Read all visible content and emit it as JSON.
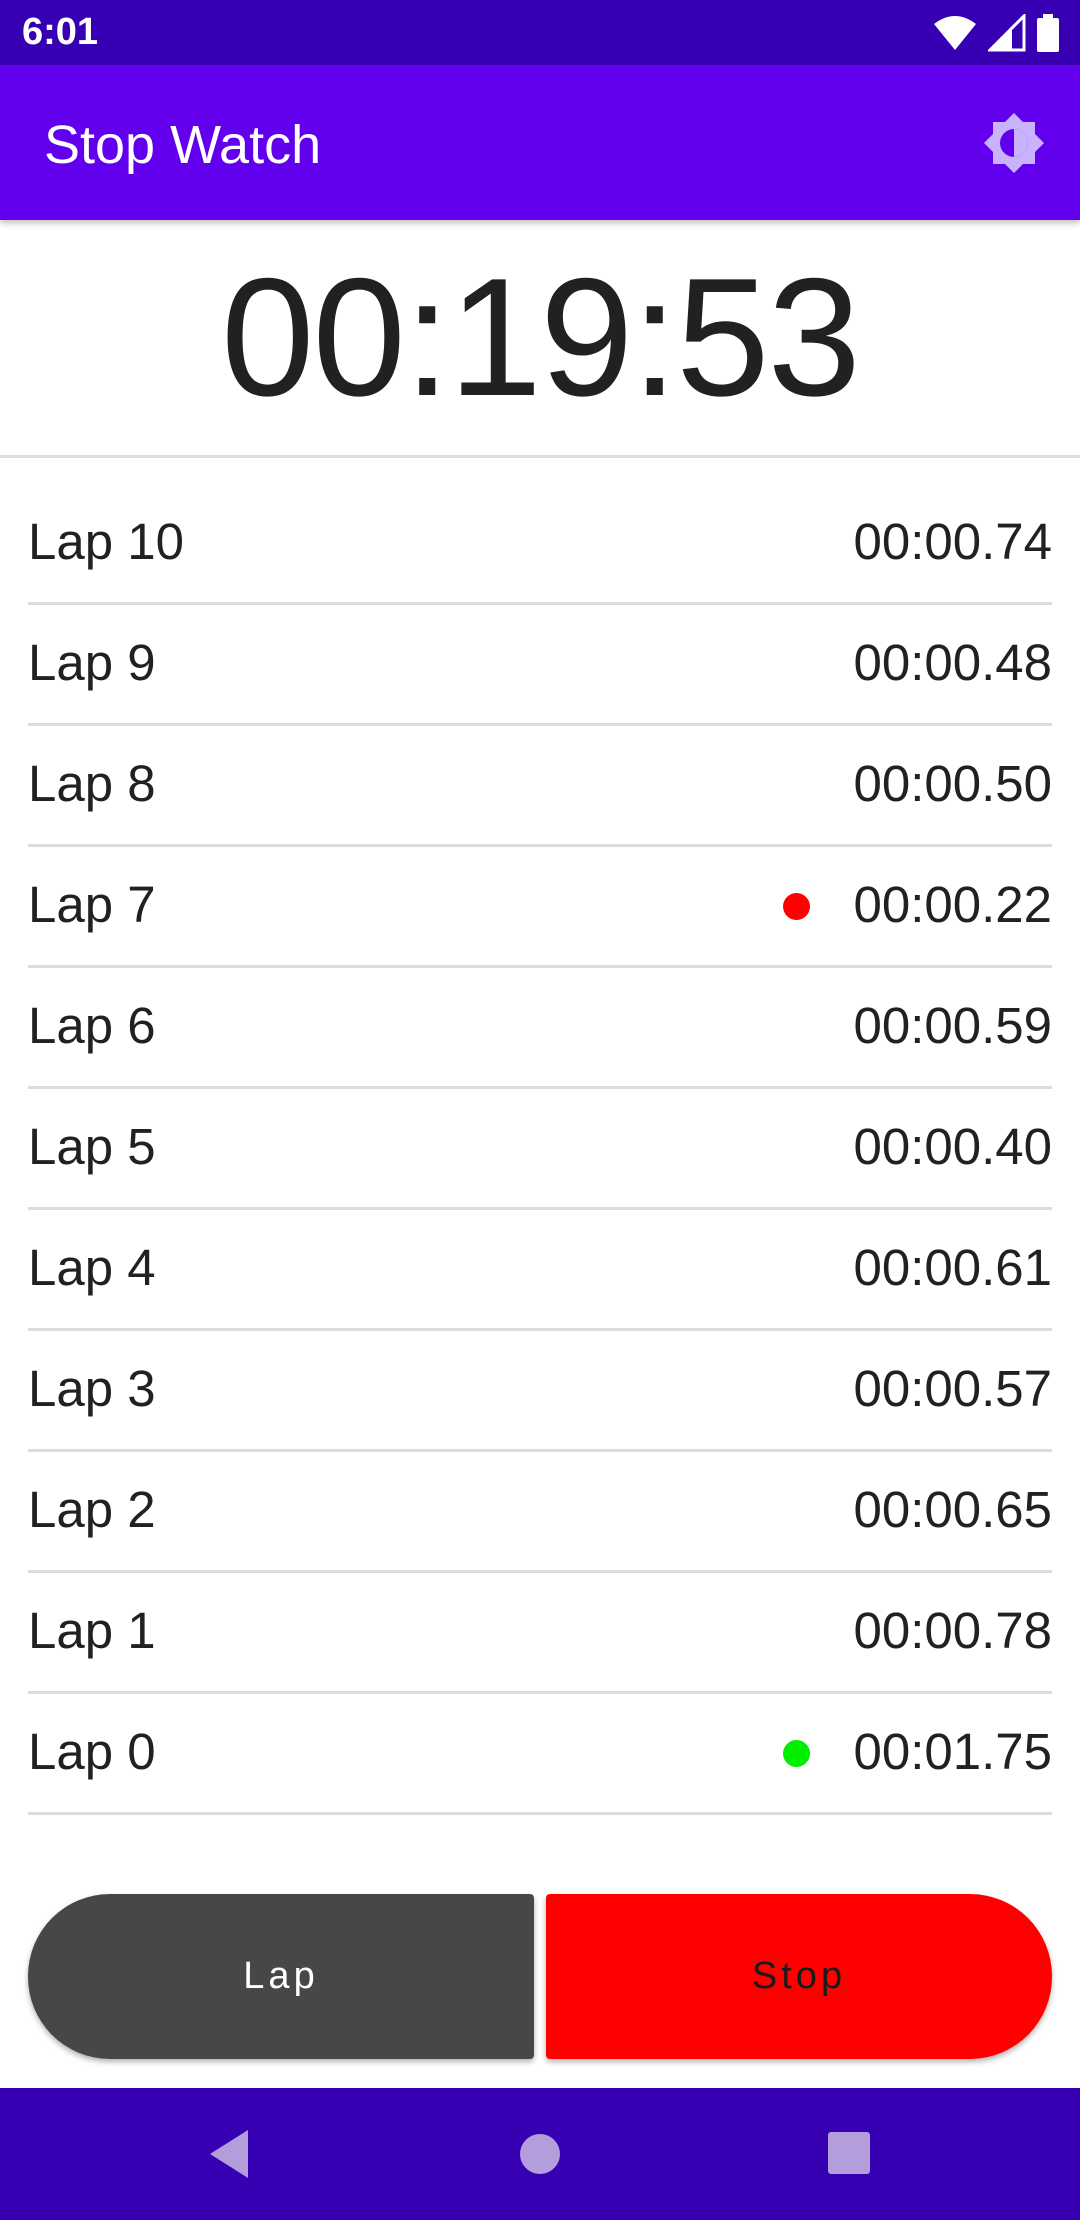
{
  "status_bar": {
    "time": "6:01"
  },
  "app_bar": {
    "title": "Stop Watch",
    "theme_icon": "brightness-icon"
  },
  "timer": {
    "value": "00:19:53"
  },
  "laps": [
    {
      "label": "Lap 10",
      "time": "00:00.74",
      "marker": null
    },
    {
      "label": "Lap 9",
      "time": "00:00.48",
      "marker": null
    },
    {
      "label": "Lap 8",
      "time": "00:00.50",
      "marker": null
    },
    {
      "label": "Lap 7",
      "time": "00:00.22",
      "marker": "#ff0000"
    },
    {
      "label": "Lap 6",
      "time": "00:00.59",
      "marker": null
    },
    {
      "label": "Lap 5",
      "time": "00:00.40",
      "marker": null
    },
    {
      "label": "Lap 4",
      "time": "00:00.61",
      "marker": null
    },
    {
      "label": "Lap 3",
      "time": "00:00.57",
      "marker": null
    },
    {
      "label": "Lap 2",
      "time": "00:00.65",
      "marker": null
    },
    {
      "label": "Lap 1",
      "time": "00:00.78",
      "marker": null
    },
    {
      "label": "Lap 0",
      "time": "00:01.75",
      "marker": "#00ee00"
    }
  ],
  "buttons": {
    "lap_label": "Lap",
    "stop_label": "Stop"
  },
  "colors": {
    "status_bar": "#3700b3",
    "app_bar": "#6200ee",
    "lap_button": "#474747",
    "stop_button": "#ff0000",
    "fastest_marker": "#ff0000",
    "slowest_marker": "#00ee00"
  }
}
